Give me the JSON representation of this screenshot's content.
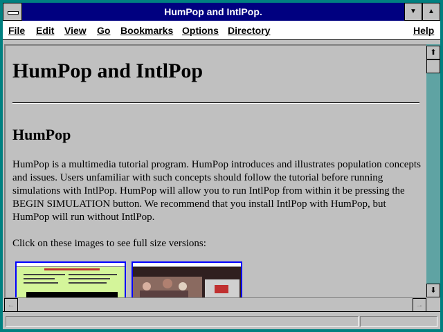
{
  "window": {
    "title": "HumPop and IntlPop."
  },
  "menubar": {
    "items": [
      "File",
      "Edit",
      "View",
      "Go",
      "Bookmarks",
      "Options",
      "Directory"
    ],
    "help": "Help"
  },
  "page": {
    "heading": "HumPop and IntlPop",
    "section_heading": "HumPop",
    "paragraph": "HumPop is a multimedia tutorial program. HumPop introduces and illustrates population concepts and issues. Users unfamiliar with such concepts should follow the tutorial before running simulations with IntlPop. HumPop will allow you to run IntlPop from within it be pressing the BEGIN SIMULATION button. We recommend that you install IntlPop with HumPop, but HumPop will run without IntlPop.",
    "images_prompt": "Click on these images to see full size versions:"
  },
  "icons": {
    "system_menu": "system-menu-icon",
    "minimize": "triangle-down",
    "maximize": "triangle-up",
    "scroll_up": "arrow-up",
    "scroll_down": "arrow-down",
    "scroll_left": "arrow-left",
    "scroll_right": "arrow-right"
  },
  "colors": {
    "titlebar": "#000080",
    "link_border": "#0000ff",
    "window_frame": "#008080"
  }
}
